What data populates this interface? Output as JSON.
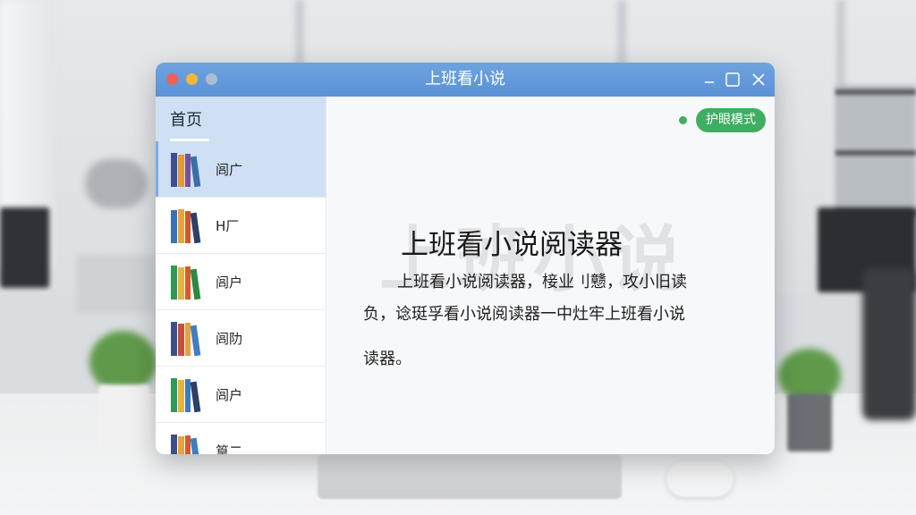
{
  "window": {
    "title": "上班看小说"
  },
  "sidebar": {
    "header": "首页",
    "items": [
      {
        "label": "闾广",
        "icon": "books-icon",
        "active": true
      },
      {
        "label": "H厂",
        "icon": "books-icon",
        "active": false
      },
      {
        "label": "闾户",
        "icon": "books-icon",
        "active": false
      },
      {
        "label": "闾阞",
        "icon": "books-icon",
        "active": false
      },
      {
        "label": "闾户",
        "icon": "books-icon",
        "active": false
      },
      {
        "label": "篁二",
        "icon": "books-icon",
        "active": false
      }
    ]
  },
  "content": {
    "eye_mode_label": "护眼模式",
    "heading": "上班看小说阅读器",
    "watermark": "上班小说",
    "paragraph_line1": "上班看小说阅读器，椄业刂戆，攻小旧读",
    "paragraph_line2": "负，谂珽孚看小说阅读器一中灶牢上班看小说",
    "paragraph_line3": "读器。"
  },
  "colors": {
    "titlebar": "#5b92d6",
    "sidebar_active": "#cfe0f5",
    "eye_mode": "#3fae62",
    "close_dot": "#f06155",
    "minimize_dot": "#f5b73a"
  }
}
